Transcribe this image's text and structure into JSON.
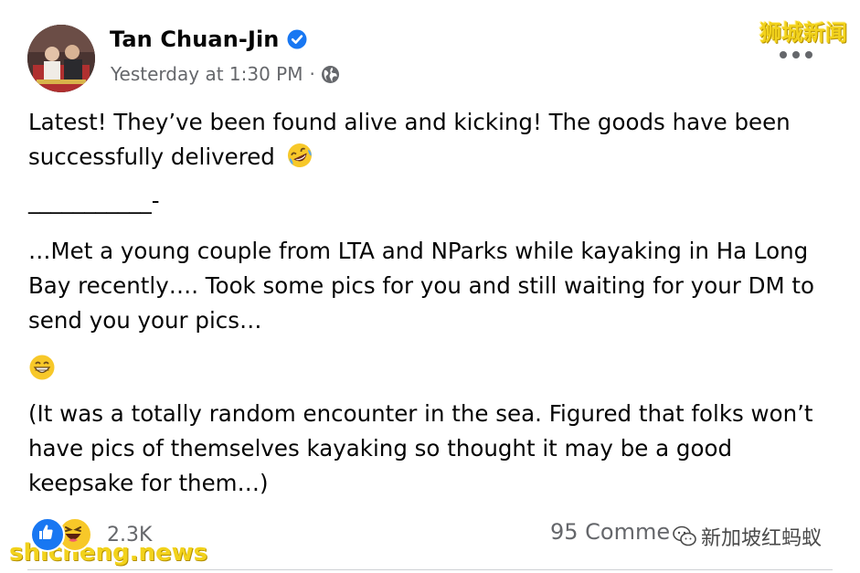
{
  "post": {
    "author": "Tan Chuan-Jin",
    "timestamp": "Yesterday at 1:30 PM",
    "separator": "·",
    "audience_icon": "globe-icon",
    "verified_icon": "verified-badge-icon",
    "more_icon": "more-horizontal-icon",
    "paragraphs": {
      "p1": "Latest! They’ve been found alive and kicking! The goods have been successfully delivered",
      "p2": "___________-",
      "p3": "…Met a young couple from LTA and NParks while kayaking in Ha Long Bay recently…. Took some pics for you and still waiting for your DM to send you your pics…",
      "p5": "(It was a totally random encounter in the sea. Figured that folks won’t have pics of themselves kayaking so thought it may be a good keepsake for them…)"
    },
    "emoji_p1": "rolling-on-floor-laughing-emoji",
    "emoji_p4": "beaming-face-emoji"
  },
  "footer": {
    "reaction_icons": [
      "like-reaction-icon",
      "haha-reaction-icon"
    ],
    "reaction_count": "2.3K",
    "comments_text": "95 Comme"
  },
  "watermarks": {
    "top_right": "狮城新闻",
    "bottom_left": "shicheng.news",
    "bottom_right": "新加坡红蚂蚁"
  },
  "colors": {
    "text": "#050505",
    "secondary": "#65676b",
    "like_blue": "#1877f2",
    "haha_yellow": "#f7c829",
    "watermark_yellow": "#f2d21b"
  }
}
